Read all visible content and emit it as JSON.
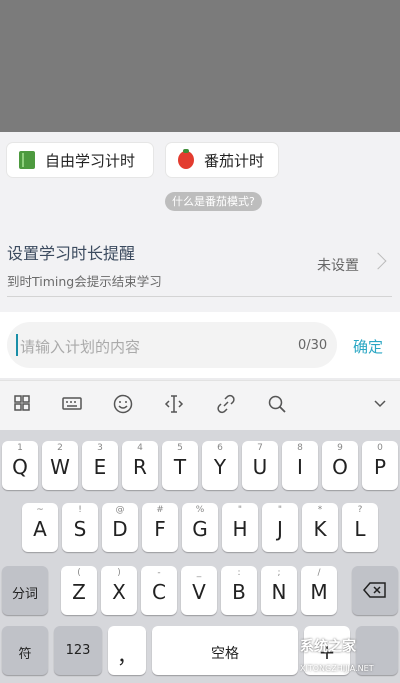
{
  "mode_buttons": {
    "free_study": "自由学习计时",
    "pomodoro": "番茄计时",
    "what_is_pomodoro": "什么是番茄模式?"
  },
  "reminder": {
    "title": "设置学习时长提醒",
    "subtitle": "到时Timing会提示结束学习",
    "value": "未设置"
  },
  "plan_input": {
    "placeholder": "请输入计划的内容",
    "counter": "0/30",
    "confirm_label": "确定"
  },
  "toolbar_icons": [
    "grid-icon",
    "keyboard-icon",
    "emoji-icon",
    "cursor-icon",
    "link-icon",
    "search-icon",
    "chevron-down-icon"
  ],
  "keyboard": {
    "row1": [
      {
        "label": "Q",
        "hint": "1"
      },
      {
        "label": "W",
        "hint": "2"
      },
      {
        "label": "E",
        "hint": "3"
      },
      {
        "label": "R",
        "hint": "4"
      },
      {
        "label": "T",
        "hint": "5"
      },
      {
        "label": "Y",
        "hint": "6"
      },
      {
        "label": "U",
        "hint": "7"
      },
      {
        "label": "I",
        "hint": "8"
      },
      {
        "label": "O",
        "hint": "9"
      },
      {
        "label": "P",
        "hint": "0"
      }
    ],
    "row2": [
      {
        "label": "A",
        "hint": "~"
      },
      {
        "label": "S",
        "hint": "!"
      },
      {
        "label": "D",
        "hint": "@"
      },
      {
        "label": "F",
        "hint": "#"
      },
      {
        "label": "G",
        "hint": "%"
      },
      {
        "label": "H",
        "hint": "\""
      },
      {
        "label": "J",
        "hint": "\""
      },
      {
        "label": "K",
        "hint": "*"
      },
      {
        "label": "L",
        "hint": "?"
      }
    ],
    "row3": [
      {
        "label": "Z",
        "hint": "("
      },
      {
        "label": "X",
        "hint": ")"
      },
      {
        "label": "C",
        "hint": "-"
      },
      {
        "label": "V",
        "hint": "_"
      },
      {
        "label": "B",
        "hint": ":"
      },
      {
        "label": "N",
        "hint": ";"
      },
      {
        "label": "M",
        "hint": "/"
      }
    ],
    "fenci": "分词",
    "symbol": "符",
    "num": "123",
    "comma": "，",
    "space": "空格",
    "plus": "+"
  },
  "watermark": {
    "title": "系统之家",
    "url": "XITONGZHIJIA.NET"
  }
}
